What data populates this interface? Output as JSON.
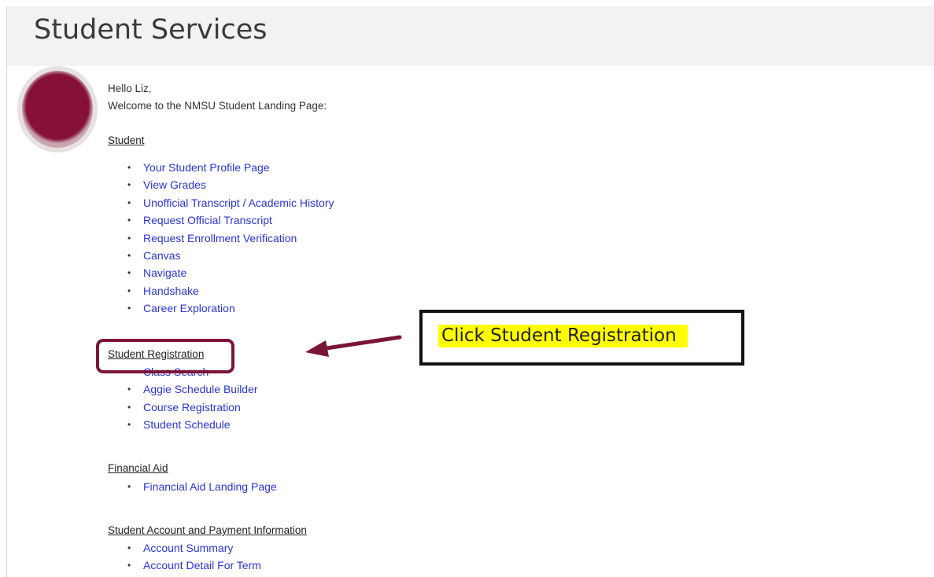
{
  "header": {
    "title": "Student Services"
  },
  "greeting": {
    "hello": "Hello Liz,",
    "welcome": "Welcome to the NMSU Student Landing Page:"
  },
  "sections": {
    "student": {
      "heading": "Student",
      "links": [
        "Your Student Profile Page",
        "View Grades",
        "Unofficial Transcript / Academic History",
        "Request Official Transcript",
        "Request Enrollment Verification",
        "Canvas",
        "Navigate",
        "Handshake",
        "Career Exploration"
      ]
    },
    "registration": {
      "heading": "Student Registration",
      "links": [
        "Class Search",
        "Aggie Schedule Builder",
        "Course Registration",
        "Student Schedule"
      ]
    },
    "financial_aid": {
      "heading": "Financial Aid",
      "links": [
        "Financial Aid Landing Page"
      ]
    },
    "account": {
      "heading": "Student Account and Payment Information",
      "links": [
        "Account Summary",
        "Account Detail For Term"
      ]
    }
  },
  "callout": {
    "text": "Click Student Registration"
  },
  "colors": {
    "link": "#2a33d6",
    "accent": "#7b1536",
    "highlight": "#ffff00"
  }
}
